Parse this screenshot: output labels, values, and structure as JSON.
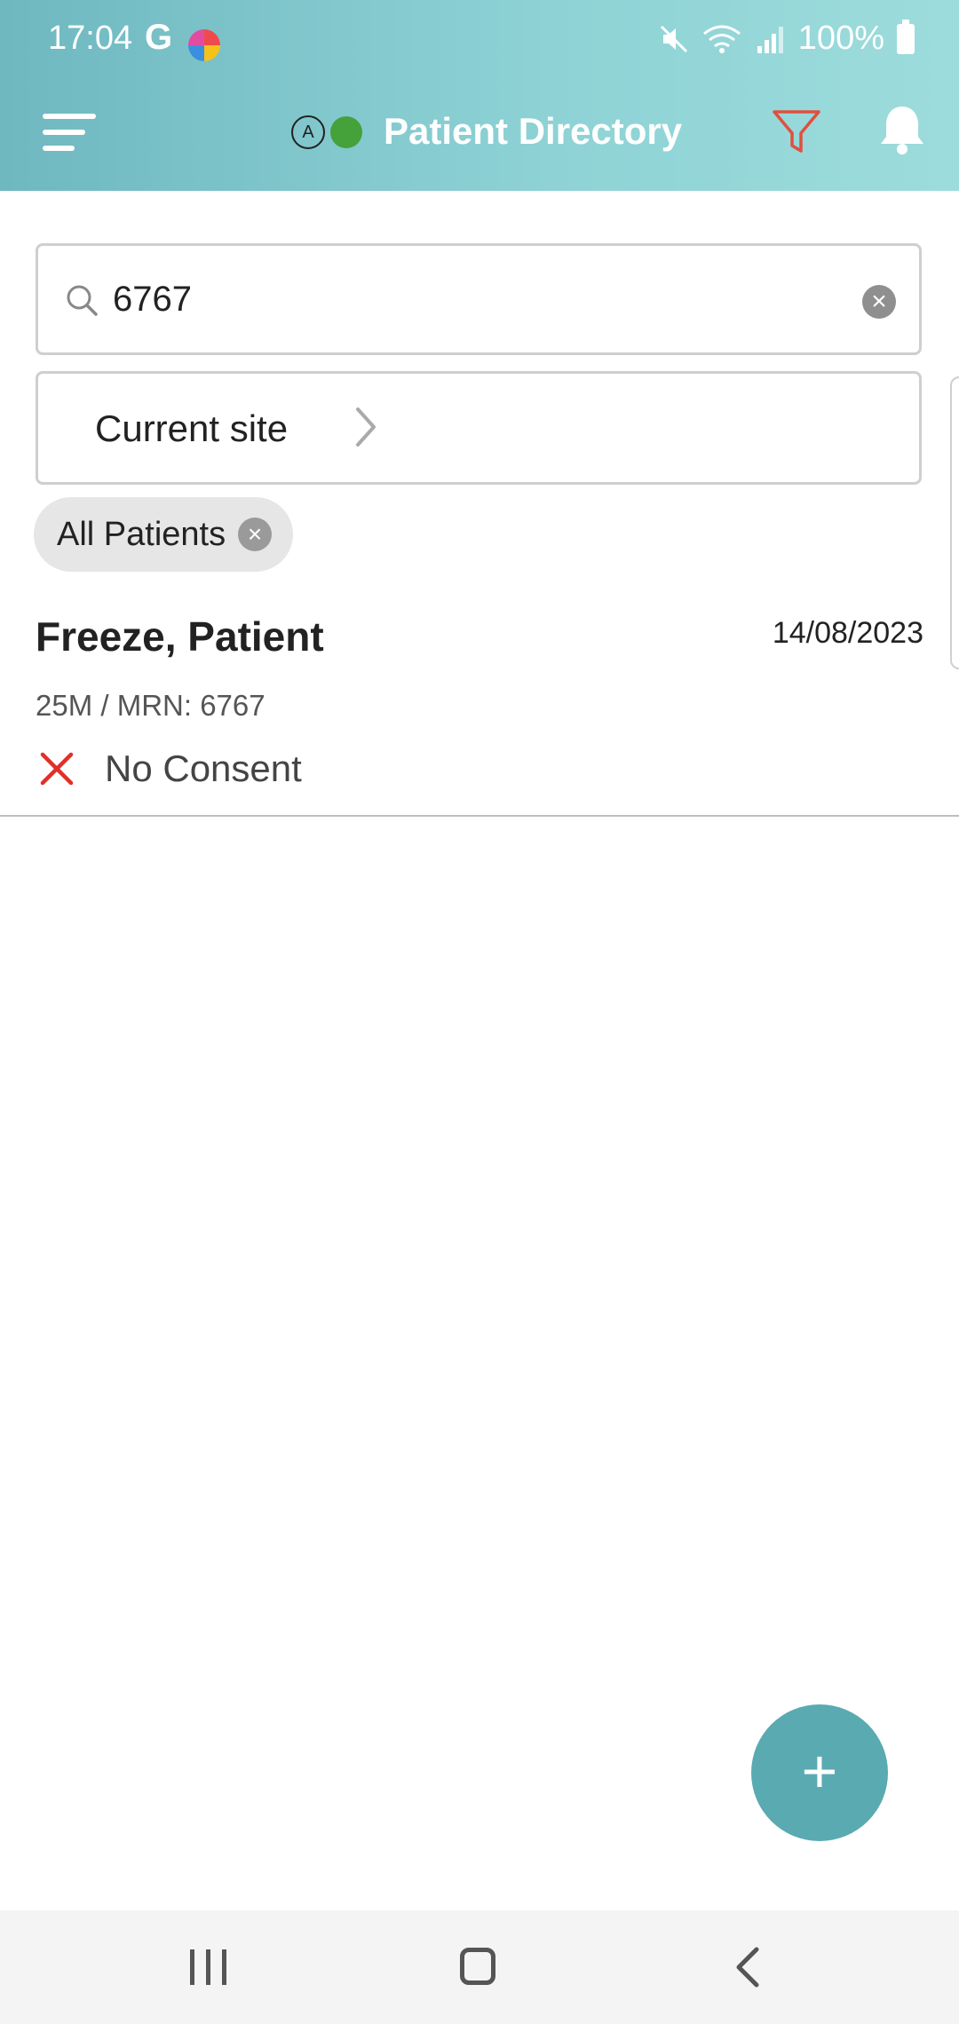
{
  "status_bar": {
    "time": "17:04",
    "g_logo": "G",
    "battery": "100%"
  },
  "header": {
    "title": "Patient Directory",
    "account_badge": "A"
  },
  "search": {
    "value": "6767",
    "clear_symbol": "×"
  },
  "site_selector": {
    "label": "Current site"
  },
  "filter_chip": {
    "label": "All Patients",
    "close_symbol": "×"
  },
  "patients": [
    {
      "name": "Freeze, Patient",
      "date": "14/08/2023",
      "meta": "25M / MRN: 6767",
      "consent": "No Consent"
    }
  ],
  "fab": {
    "label": "+"
  },
  "colors": {
    "header_gradient_start": "#6fb8c0",
    "header_gradient_end": "#9ddcdc",
    "accent": "#5aaab1",
    "online": "#45a13a",
    "filter_icon": "#e0503e",
    "no_consent": "#e0302a"
  },
  "icons": {
    "menu": "menu-icon",
    "filter": "filter-icon",
    "bell": "bell-icon",
    "search": "search-icon",
    "clear": "clear-icon",
    "chevron": "chevron-right-icon",
    "consent": "x-mark-icon"
  }
}
